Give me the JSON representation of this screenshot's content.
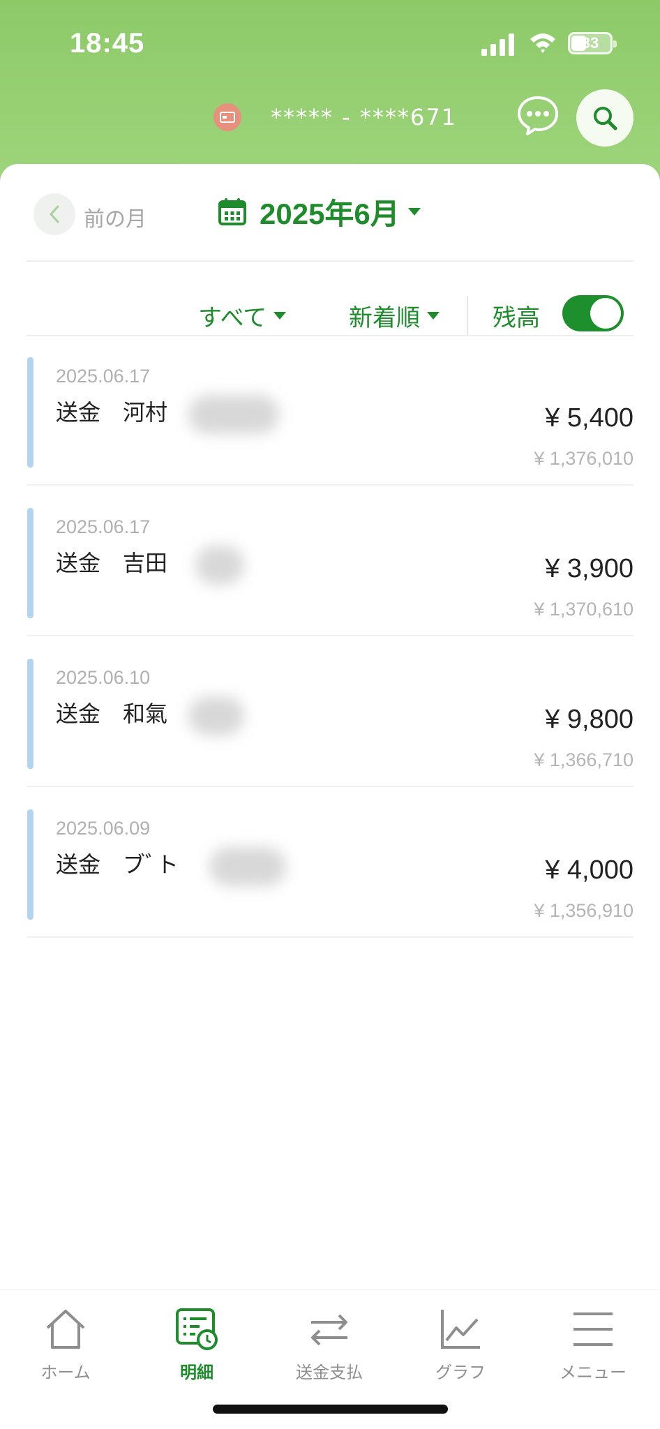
{
  "status_bar": {
    "time": "18:45",
    "battery": "33",
    "signal_icon": "cellular-signal-icon",
    "wifi_icon": "wifi-icon"
  },
  "header": {
    "account_number": "***** - ****671",
    "account_icon": "card-icon",
    "chat_icon": "chat-bubble-icon",
    "search_icon": "search-icon"
  },
  "month_nav": {
    "prev_label": "前の月",
    "current_month": "2025年6月",
    "calendar_icon": "calendar-icon"
  },
  "filters": {
    "type_label": "すべて",
    "sort_label": "新着順",
    "balance_label": "残高",
    "balance_toggle_on": true
  },
  "transactions": [
    {
      "date": "2025.06.17",
      "desc": "送金　河村",
      "amount": "¥ 5,400",
      "balance": "¥ 1,376,010"
    },
    {
      "date": "2025.06.17",
      "desc": "送金　吉田",
      "amount": "¥ 3,900",
      "balance": "¥ 1,370,610"
    },
    {
      "date": "2025.06.10",
      "desc": "送金　和氣",
      "amount": "¥ 9,800",
      "balance": "¥ 1,366,710"
    },
    {
      "date": "2025.06.09",
      "desc": "送金　ブﾞト",
      "amount": "¥ 4,000",
      "balance": "¥ 1,356,910"
    }
  ],
  "tabbar": {
    "home": "ホーム",
    "statement": "明細",
    "transfer": "送金支払",
    "graph": "グラフ",
    "menu": "メニュー"
  },
  "colors": {
    "accent": "#1f8c2c",
    "header_gradient_top": "#8cca68",
    "header_gradient_bottom": "#9fd57c",
    "transaction_bar": "#b3d4ef"
  }
}
